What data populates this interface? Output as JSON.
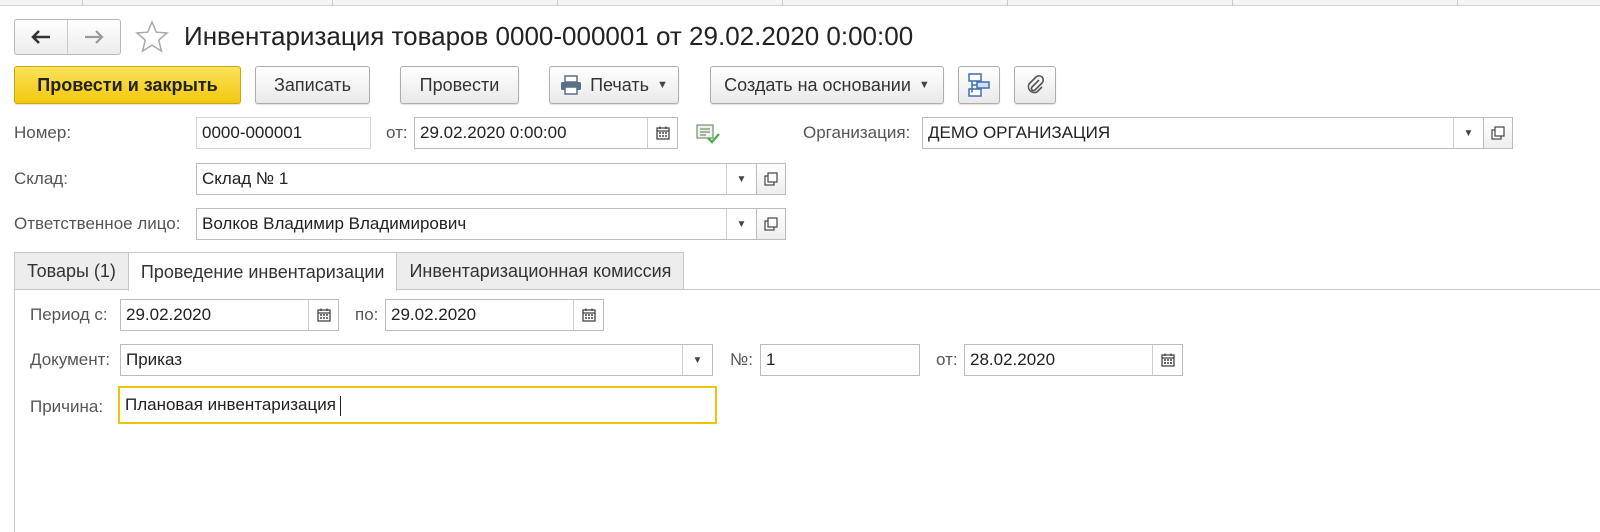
{
  "window": {
    "title": "Инвентаризация товаров 0000-000001 от 29.02.2020 0:00:00"
  },
  "nav": {
    "back_icon": "arrow-left-icon",
    "forward_icon": "arrow-right-icon",
    "favorite_icon": "star-icon"
  },
  "toolbar": {
    "post_and_close": "Провести и закрыть",
    "save": "Записать",
    "post": "Провести",
    "print": "Печать",
    "create_based_on": "Создать на основании",
    "structure_icon": "structure-icon",
    "attach_icon": "paperclip-icon"
  },
  "header": {
    "number_label": "Номер:",
    "number_value": "0000-000001",
    "date_label": "от:",
    "date_value": "29.02.2020  0:00:00",
    "org_label": "Организация:",
    "org_value": "ДЕМО ОРГАНИЗАЦИЯ",
    "warehouse_label": "Склад:",
    "warehouse_value": "Склад № 1",
    "responsible_label": "Ответственное лицо:",
    "responsible_value": "Волков Владимир Владимирович"
  },
  "tabs": [
    {
      "label": "Товары (1)",
      "active": false
    },
    {
      "label": "Проведение инвентаризации",
      "active": true
    },
    {
      "label": "Инвентаризационная комиссия",
      "active": false
    }
  ],
  "inventory": {
    "period_from_label": "Период с:",
    "period_from_value": "29.02.2020",
    "period_to_label": "по:",
    "period_to_value": "29.02.2020",
    "document_label": "Документ:",
    "document_value": "Приказ",
    "doc_number_label": "№:",
    "doc_number_value": "1",
    "doc_date_label": "от:",
    "doc_date_value": "28.02.2020",
    "reason_label": "Причина:",
    "reason_value": "Плановая инвентаризация"
  },
  "colors": {
    "primary_button": "#f2c80e",
    "focus_border": "#f0c40b",
    "posted_check": "#4caf50"
  }
}
